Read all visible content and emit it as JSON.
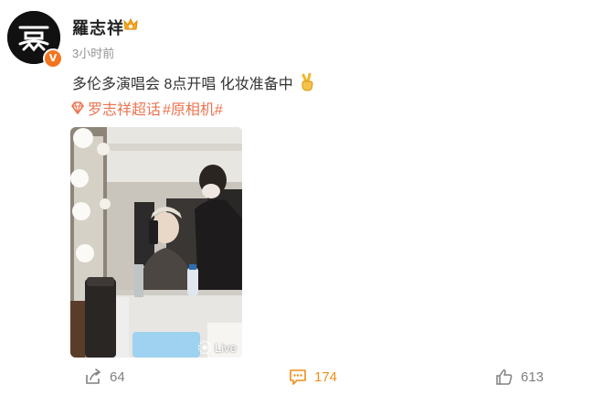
{
  "user": {
    "name": "羅志祥",
    "verified_badge": "V",
    "avatar_icon": "avatar-logo-icon",
    "rank_icon": "fan-rank-crown-icon"
  },
  "post": {
    "timestamp": "3小时前",
    "text": "多伦多演唱会 8点开唱 化妆准备中",
    "emoji_icon": "victory-hand-icon",
    "topic": {
      "icon": "super-topic-diamond-icon",
      "name": "罗志祥超话",
      "hashtag": "#原相机#"
    },
    "image": {
      "live_label": "Live"
    }
  },
  "actions": {
    "share_count": "64",
    "comment_count": "174",
    "like_count": "613"
  },
  "colors": {
    "link": "#eb7350",
    "comment_active": "#f18e1a",
    "muted": "#939393",
    "badge": "#f5741f"
  }
}
